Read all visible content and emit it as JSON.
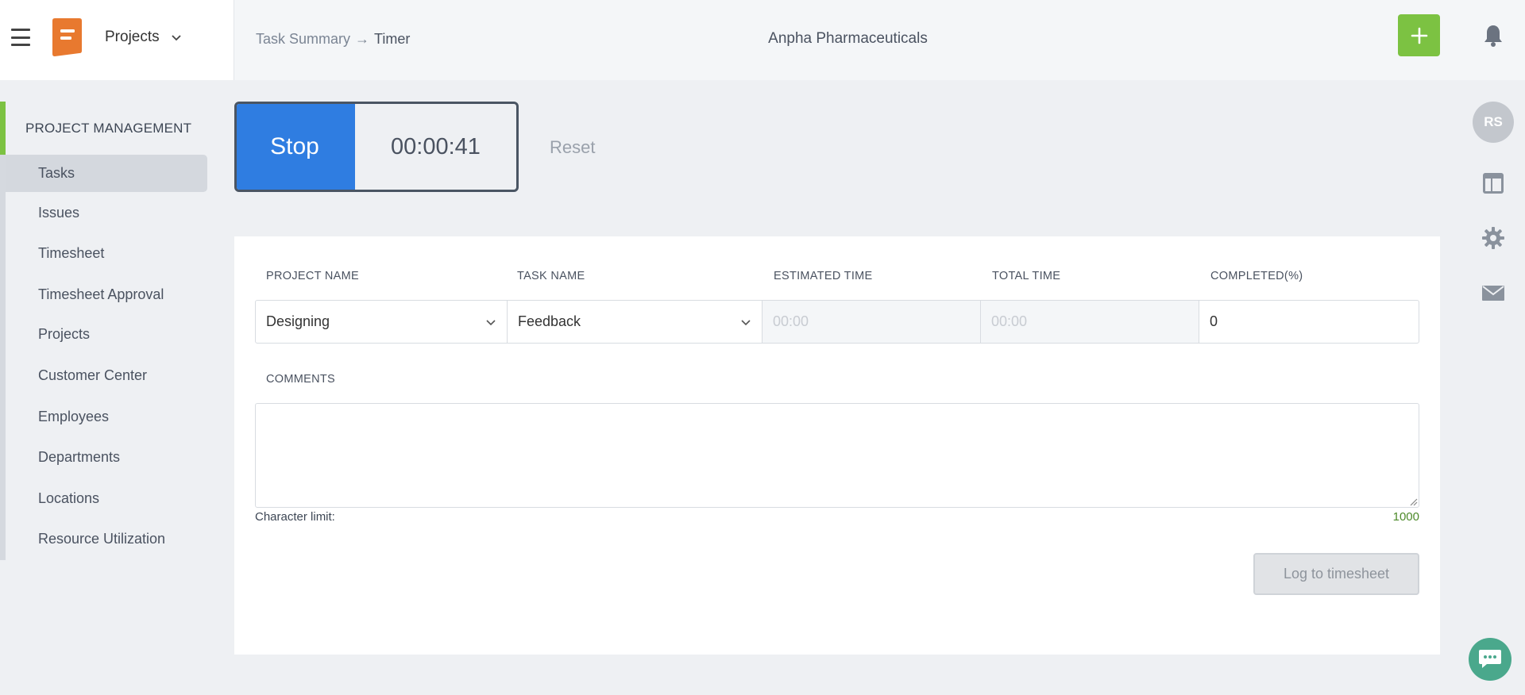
{
  "header": {
    "app_switcher_label": "Projects",
    "breadcrumb": {
      "parent": "Task Summary",
      "separator": "→",
      "current": "Timer"
    },
    "organization": "Anpha Pharmaceuticals",
    "add_button_icon": "plus-icon",
    "notification_icon": "bell-icon"
  },
  "sidebar": {
    "heading": "PROJECT MANAGEMENT",
    "items": [
      {
        "label": "Tasks",
        "active": true
      },
      {
        "label": "Issues"
      },
      {
        "label": "Timesheet"
      },
      {
        "label": "Timesheet Approval"
      },
      {
        "label": "Projects"
      },
      {
        "label": "Customer Center"
      },
      {
        "label": "Employees"
      },
      {
        "label": "Departments"
      },
      {
        "label": "Locations"
      },
      {
        "label": "Resource Utilization"
      }
    ]
  },
  "right_rail": {
    "avatar_initials": "RS",
    "icons": [
      "layout-icon",
      "gear-icon",
      "mail-icon",
      "chat-icon"
    ]
  },
  "timer": {
    "stop_label": "Stop",
    "elapsed": "00:00:41",
    "reset_label": "Reset"
  },
  "form": {
    "columns": {
      "project_name": "PROJECT NAME",
      "task_name": "TASK NAME",
      "estimated_time": "ESTIMATED TIME",
      "total_time": "TOTAL TIME",
      "completed": "COMPLETED(%)"
    },
    "values": {
      "project_name": "Designing",
      "task_name": "Feedback",
      "estimated_time_placeholder": "00:00",
      "total_time_placeholder": "00:00",
      "completed": "0"
    },
    "comments_label": "COMMENTS",
    "comments_value": "",
    "char_limit_label": "Character limit:",
    "char_limit_value": "1000",
    "log_button": "Log to timesheet"
  },
  "colors": {
    "accent_green": "#7cc242",
    "stop_blue": "#2f7de1",
    "chat_teal": "#4aa88c",
    "logo_orange": "#e8792f"
  }
}
